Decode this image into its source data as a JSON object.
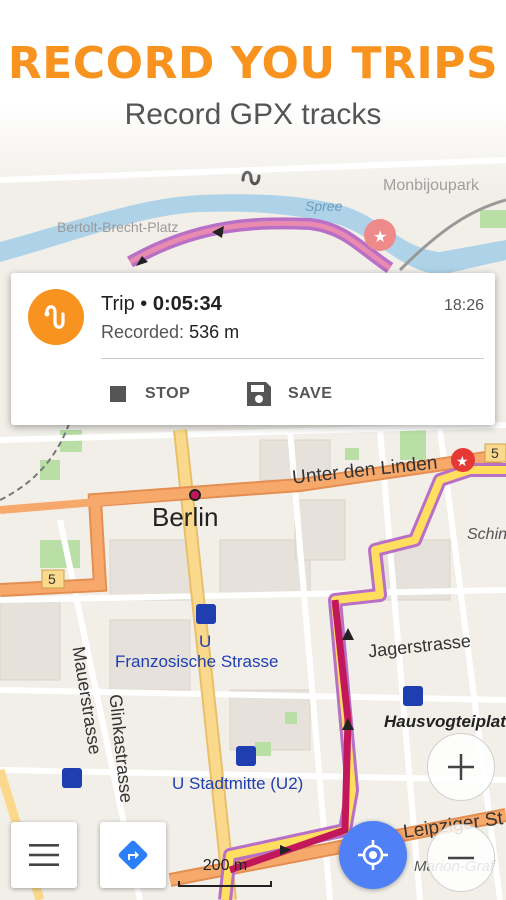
{
  "header": {
    "headline": "RECORD YOU TRIPS",
    "subheadline": "Record GPX tracks"
  },
  "map": {
    "labels": {
      "monbijoupark": "Monbijoupark",
      "bertolt": "Bertolt-Brecht-Platz",
      "spree": "Spree",
      "unter_den_linden": "Unter den Linden",
      "berlin": "Berlin",
      "schinkel": "Schink",
      "route_5_a": "5",
      "route_5_b": "5",
      "mauerstrasse": "Mauerstrasse",
      "glinkastrasse": "Glinkastrasse",
      "jagerstrasse": "Jagerstrasse",
      "franzosische": "Franzosische Strasse",
      "hausvogtei": "Hausvogteiplatz",
      "stadtmitte": "U Stadtmitte (U2)",
      "leipziger": "Leipziger St",
      "marion": "Marion-Graf",
      "u_letter": "U"
    },
    "colors": {
      "background": "#f2efe9",
      "main_road": "#f7a96b",
      "secondary_road": "#fbd98c",
      "track": "#c2185b",
      "track_outline": "#b86fc6",
      "route": "#ffdf5d",
      "water": "#aed3e8",
      "park": "#b9dfa6",
      "transit": "#1f3fb0",
      "accent": "#f7931e",
      "location": "#4f80f5"
    }
  },
  "trip_card": {
    "title_prefix": "Trip • ",
    "duration": "0:05:34",
    "clock": "18:26",
    "recorded_label": "Recorded: ",
    "recorded_value": "536 m",
    "stop_label": "STOP",
    "save_label": "SAVE",
    "icon": "track-recording-icon"
  },
  "controls": {
    "menu_icon": "hamburger-menu-icon",
    "directions_icon": "directions-icon",
    "zoom_in_icon": "plus-icon",
    "zoom_out_icon": "minus-icon",
    "location_icon": "my-location-icon",
    "scale_label": "200 m"
  }
}
